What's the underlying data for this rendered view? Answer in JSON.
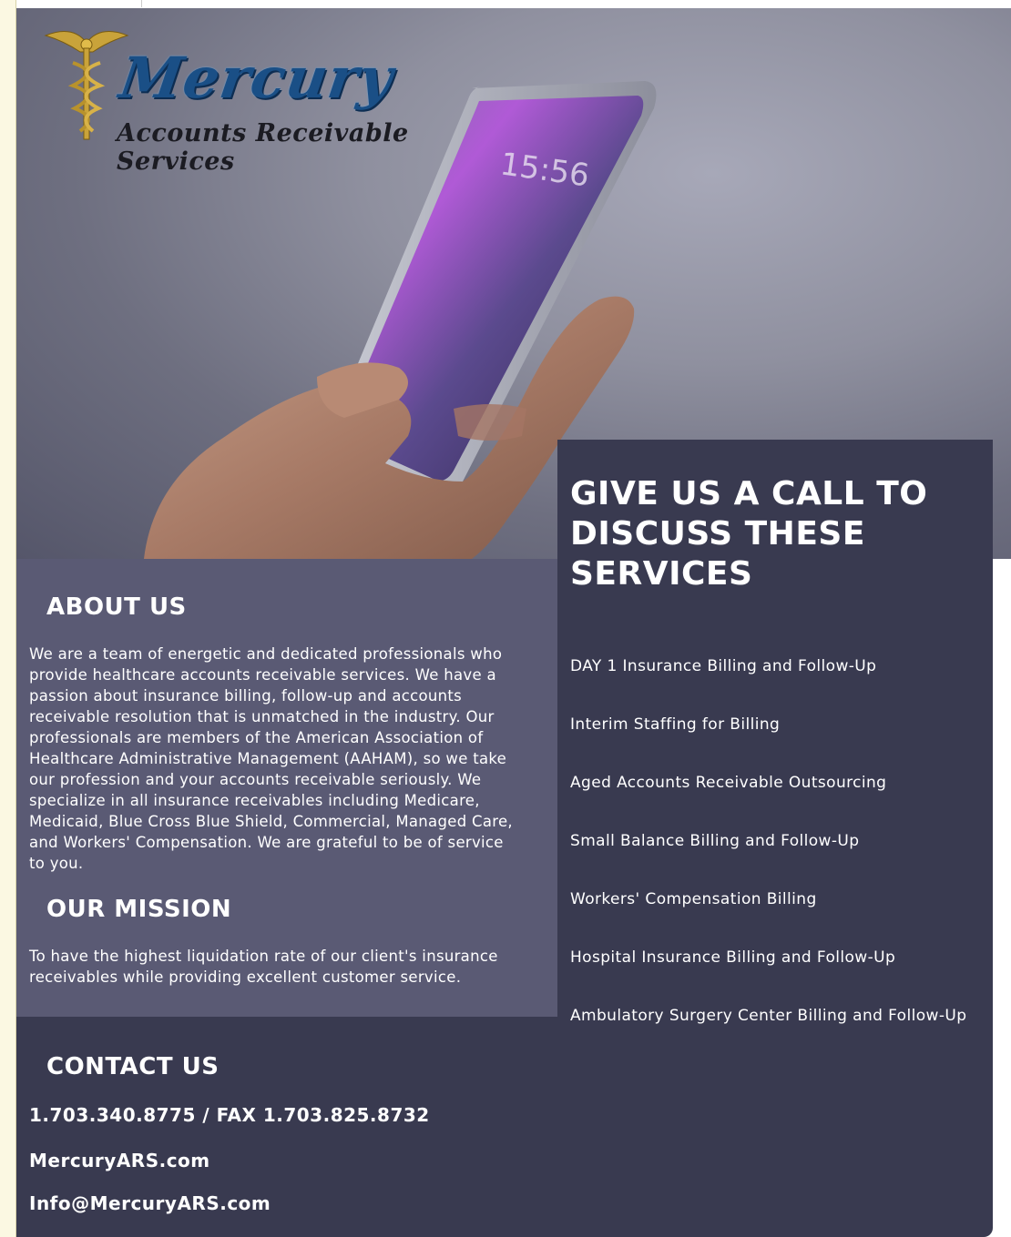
{
  "logo": {
    "name": "Mercury",
    "tagline": "Accounts Receivable Services"
  },
  "hero": {
    "phone_time": "15:56"
  },
  "about": {
    "title": "ABOUT US",
    "body": "We are a team of energetic and dedicated professionals who provide healthcare accounts receivable services. We have a passion about insurance billing, follow-up and accounts receivable resolution that is unmatched in the industry. Our professionals are members of the American Association of Healthcare Administrative Management (AAHAM), so we take our profession and your accounts receivable seriously. We specialize in all insurance receivables including Medicare, Medicaid, Blue Cross Blue Shield, Commercial, Managed Care, and Workers' Compensation. We are grateful to be of service to you."
  },
  "mission": {
    "title": "OUR MISSION",
    "body": "To have the highest liquidation rate of our client's insurance receivables while providing excellent customer service."
  },
  "contact": {
    "title": "CONTACT US",
    "phone": "1.703.340.8775 / FAX 1.703.825.8732",
    "website": "MercuryARS.com",
    "email": "Info@MercuryARS.com"
  },
  "services": {
    "title": "GIVE US A CALL TO DISCUSS THESE SERVICES",
    "items": [
      "DAY 1 Insurance Billing and Follow-Up",
      "Interim Staffing for Billing",
      "Aged Accounts Receivable Outsourcing",
      "Small Balance Billing and Follow-Up",
      "Workers' Compensation Billing",
      "Hospital Insurance Billing and Follow-Up",
      "Ambulatory Surgery Center Billing and Follow-Up"
    ]
  },
  "colors": {
    "logo_blue": "#1a4f86",
    "panel_light": "#5a5a74",
    "panel_dark": "#393a50",
    "text": "#ffffff"
  }
}
